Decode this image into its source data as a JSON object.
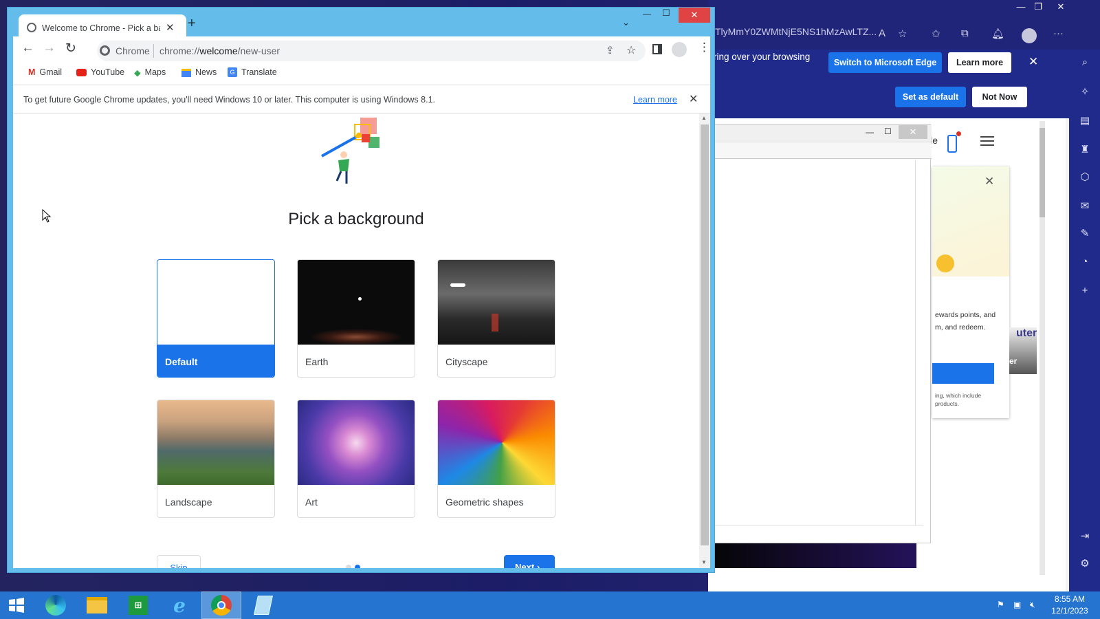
{
  "edge": {
    "address_text": "TlyMmY0ZWMtNjE5NS1hMzAwLTZ...",
    "banner_text": "ring over your browsing",
    "switch_button": "Switch to Microsoft Edge",
    "learn_more_button": "Learn more",
    "set_default_button": "Set as default",
    "not_now_button": "Not Now",
    "page_partial_text": "ile",
    "card_text_1": "ewards points, and",
    "card_text_2": "m, and redeem.",
    "card_text_3": "ing, which include",
    "card_text_4": "products.",
    "card_side_text": "uter",
    "card_side_text_2": "er"
  },
  "chrome": {
    "tab_title": "Welcome to Chrome - Pick a bac",
    "omnibox_site": "Chrome",
    "omnibox_url_prefix": "chrome://",
    "omnibox_url_host": "welcome",
    "omnibox_url_path": "/new-user",
    "bookmarks": [
      {
        "label": "Gmail",
        "icon": "gmail-icon"
      },
      {
        "label": "YouTube",
        "icon": "youtube-icon"
      },
      {
        "label": "Maps",
        "icon": "maps-icon"
      },
      {
        "label": "News",
        "icon": "news-icon"
      },
      {
        "label": "Translate",
        "icon": "translate-icon"
      }
    ],
    "infobar_text": "To get future Google Chrome updates, you'll need Windows 10 or later. This computer is using Windows 8.1.",
    "infobar_link": "Learn more",
    "page_heading": "Pick a background",
    "backgrounds": [
      {
        "label": "Default",
        "selected": true
      },
      {
        "label": "Earth",
        "selected": false
      },
      {
        "label": "Cityscape",
        "selected": false
      },
      {
        "label": "Landscape",
        "selected": false
      },
      {
        "label": "Art",
        "selected": false
      },
      {
        "label": "Geometric shapes",
        "selected": false
      }
    ],
    "skip_button": "Skip",
    "next_button": "Next",
    "step_current": 2,
    "step_total": 2
  },
  "taskbar": {
    "time": "8:55 AM",
    "date": "12/1/2023"
  },
  "colors": {
    "chrome_frame": "#64bcea",
    "accent_blue": "#1a73e8",
    "taskbar": "#2574cf",
    "edge_frame": "#20257a"
  }
}
